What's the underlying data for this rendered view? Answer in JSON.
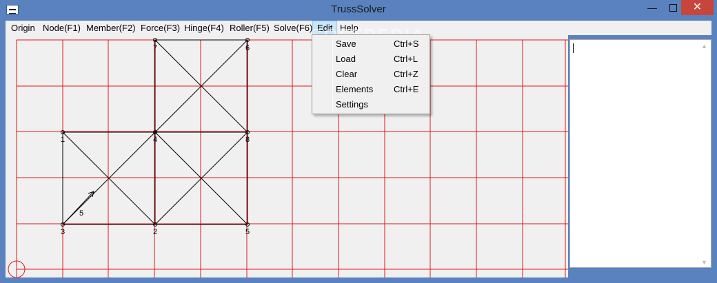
{
  "window": {
    "title": "TrussSolver",
    "minimize_glyph": "—",
    "close_glyph": "✕"
  },
  "menu": [
    {
      "label": "Origin",
      "id": "origin"
    },
    {
      "label": "Node(F1)",
      "id": "node"
    },
    {
      "label": "Member(F2)",
      "id": "member"
    },
    {
      "label": "Force(F3)",
      "id": "force"
    },
    {
      "label": "Hinge(F4)",
      "id": "hinge"
    },
    {
      "label": "Roller(F5)",
      "id": "roller"
    },
    {
      "label": "Solve(F6)",
      "id": "solve"
    },
    {
      "label": "Edit",
      "id": "edit",
      "active": true
    },
    {
      "label": "Help",
      "id": "help"
    }
  ],
  "edit_menu": [
    {
      "label": "Save",
      "shortcut": "Ctrl+S"
    },
    {
      "label": "Load",
      "shortcut": "Ctrl+L"
    },
    {
      "label": "Clear",
      "shortcut": "Ctrl+Z"
    },
    {
      "label": "Elements",
      "shortcut": "Ctrl+E"
    },
    {
      "label": "Settings",
      "shortcut": ""
    }
  ],
  "canvas": {
    "grid_color": "#e2161c",
    "line_color": "#000000",
    "nodes": [
      {
        "id": "1",
        "col": 1,
        "row": 2
      },
      {
        "id": "2",
        "col": 3,
        "row": 4
      },
      {
        "id": "3",
        "col": 1,
        "row": 4
      },
      {
        "id": "4",
        "col": 3,
        "row": 2
      },
      {
        "id": "5",
        "col": 5,
        "row": 4
      },
      {
        "id": "6",
        "col": 5,
        "row": 0
      },
      {
        "id": "7",
        "col": 3,
        "row": 0
      },
      {
        "id": "8",
        "col": 5,
        "row": 2
      }
    ],
    "members": [
      [
        "7",
        "6"
      ],
      [
        "7",
        "4"
      ],
      [
        "6",
        "8"
      ],
      [
        "7",
        "8"
      ],
      [
        "6",
        "4"
      ],
      [
        "1",
        "4"
      ],
      [
        "4",
        "8"
      ],
      [
        "1",
        "3"
      ],
      [
        "3",
        "2"
      ],
      [
        "2",
        "5"
      ],
      [
        "4",
        "2"
      ],
      [
        "8",
        "5"
      ],
      [
        "1",
        "2"
      ],
      [
        "3",
        "4"
      ],
      [
        "4",
        "5"
      ],
      [
        "8",
        "2"
      ]
    ],
    "force": {
      "label": "5"
    }
  },
  "watermark": "SOFTPEDIA"
}
